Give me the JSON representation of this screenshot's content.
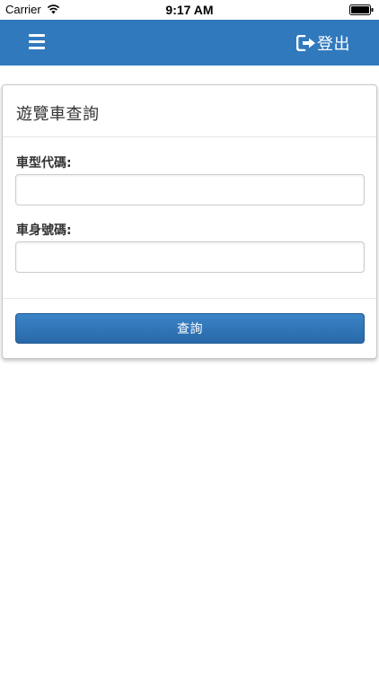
{
  "status_bar": {
    "carrier": "Carrier",
    "time": "9:17 AM",
    "icons": [
      "wifi-icon",
      "battery-icon"
    ]
  },
  "nav": {
    "menu_icon": "hamburger-menu-icon",
    "logout_icon": "logout-icon",
    "logout_label": "登出",
    "background_color": "#3079bd"
  },
  "panel": {
    "title": "遊覽車查詢",
    "fields": [
      {
        "label": "車型代碼:",
        "value": "",
        "placeholder": ""
      },
      {
        "label": "車身號碼:",
        "value": "",
        "placeholder": ""
      }
    ],
    "submit_label": "查詢"
  }
}
